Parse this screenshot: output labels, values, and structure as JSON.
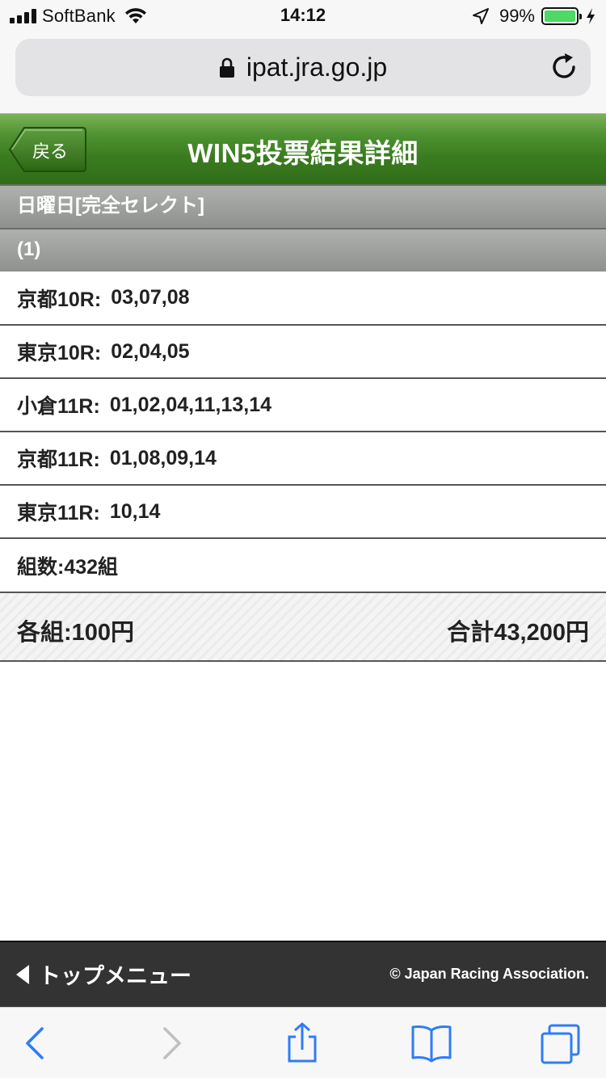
{
  "status_bar": {
    "carrier": "SoftBank",
    "time": "14:12",
    "battery_percent": "99%",
    "battery_level": 0.99,
    "battery_color": "#4cd964"
  },
  "browser": {
    "url": "ipat.jra.go.jp",
    "icons": [
      "lock-icon",
      "reload-icon"
    ]
  },
  "header": {
    "back_label": "戻る",
    "title": "WIN5投票結果詳細",
    "color": "#3b7c20"
  },
  "sections": {
    "day": "日曜日[完全セレクト]",
    "number": "(1)"
  },
  "races": [
    {
      "race": "京都10R:",
      "selection": "03,07,08"
    },
    {
      "race": "東京10R:",
      "selection": "02,04,05"
    },
    {
      "race": "小倉11R:",
      "selection": "01,02,04,11,13,14"
    },
    {
      "race": "京都11R:",
      "selection": "01,08,09,14"
    },
    {
      "race": "東京11R:",
      "selection": "10,14"
    }
  ],
  "combinations": "組数:432組",
  "amounts": {
    "each": "各組:100円",
    "total": "合計43,200円"
  },
  "footer": {
    "top_menu": "トップメニュー",
    "copyright": "© Japan Racing Association."
  },
  "toolbar": {
    "icons": [
      "back-arrow-icon",
      "forward-arrow-icon",
      "share-icon",
      "bookmarks-icon",
      "tabs-icon"
    ],
    "accent": "#2f7cf6"
  }
}
